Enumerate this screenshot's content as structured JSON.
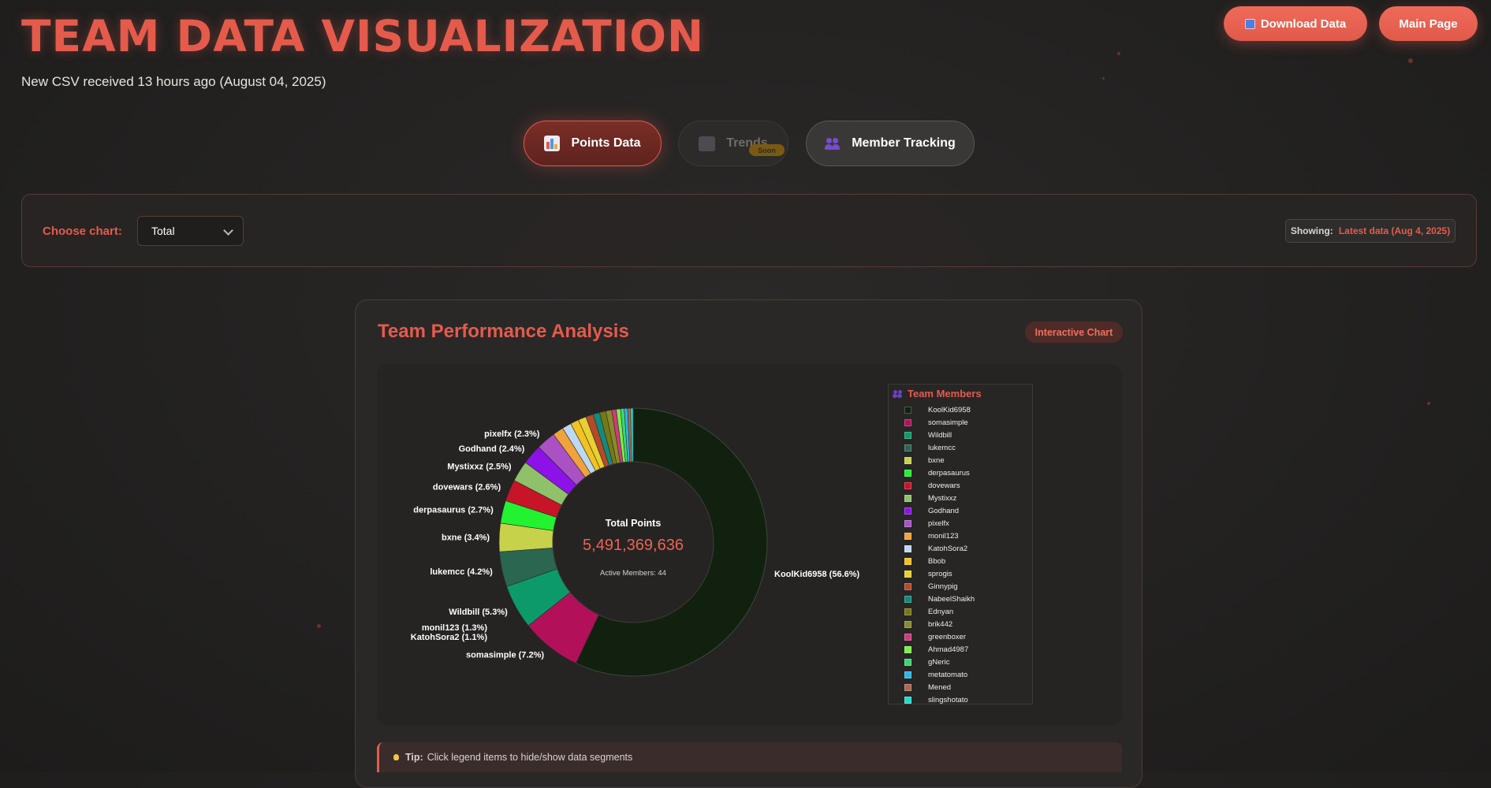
{
  "header": {
    "title": "TEAM DATA VISUALIZATION",
    "subtitle": "New CSV received 13 hours ago (August 04, 2025)",
    "download_label": "Download Data",
    "main_page_label": "Main Page"
  },
  "tabs": [
    {
      "label": "Points Data",
      "state": "active",
      "icon": "bar-chart-icon"
    },
    {
      "label": "Trends",
      "state": "disabled",
      "badge": "Soon",
      "icon": "trend-chart-icon"
    },
    {
      "label": "Member Tracking",
      "state": "default",
      "icon": "people-icon"
    }
  ],
  "controls": {
    "choose_label": "Choose chart:",
    "select_value": "Total",
    "showing_label": "Showing:",
    "showing_value": "Latest data (Aug 4, 2025)"
  },
  "card": {
    "title": "Team Performance Analysis",
    "badge": "Interactive Chart",
    "tip_strong": "Tip:",
    "tip_text": "Click legend items to hide/show data segments"
  },
  "colors": {
    "accent": "#e45b4c",
    "background": "#222120"
  },
  "chart_data": {
    "type": "pie",
    "variant": "doughnut",
    "center_label": "Total Points",
    "center_value": "5,491,369,636",
    "center_sub": "Active Members: 44",
    "legend_title": "Team Members",
    "labels": [
      "KoolKid6958",
      "somasimple",
      "Wildbill",
      "lukemcc",
      "bxne",
      "derpasaurus",
      "dovewars",
      "Mystixxz",
      "Godhand",
      "pixelfx",
      "monil123",
      "KatohSora2",
      "Bbob",
      "sprogis",
      "Ginnypig",
      "NabeelShaikh",
      "Ednyan",
      "brik442",
      "greenboxer",
      "Ahmad4987",
      "gNeric",
      "metatomato",
      "Mened",
      "slingshotato"
    ],
    "values": [
      56.6,
      7.2,
      5.3,
      4.2,
      3.4,
      2.7,
      2.6,
      2.5,
      2.4,
      2.3,
      1.3,
      1.1,
      1.0,
      0.95,
      0.9,
      0.8,
      0.75,
      0.7,
      0.55,
      0.5,
      0.45,
      0.4,
      0.35,
      0.3
    ],
    "colors": [
      "#12200f",
      "#b3105a",
      "#0d9a6a",
      "#2a6650",
      "#c6d24a",
      "#22f230",
      "#c71427",
      "#8fc06a",
      "#8c12e8",
      "#aa52c3",
      "#f0a23c",
      "#bcd8f2",
      "#f2c220",
      "#e8d030",
      "#b34a2a",
      "#138a7a",
      "#777816",
      "#8a8a2a",
      "#d03a7a",
      "#7af04a",
      "#3ad870",
      "#2ab8e8",
      "#a86a52",
      "#28d8cf"
    ],
    "data_labels": [
      "KoolKid6958 (56.6%)",
      "somasimple (7.2%)",
      "Wildbill (5.3%)",
      "lukemcc (4.2%)",
      "bxne (3.4%)",
      "derpasaurus (2.7%)",
      "dovewars (2.6%)",
      "Mystixxz (2.5%)",
      "Godhand (2.4%)",
      "pixelfx (2.3%)",
      "monil123 (1.3%)",
      "KatohSora2 (1.1%)"
    ]
  }
}
